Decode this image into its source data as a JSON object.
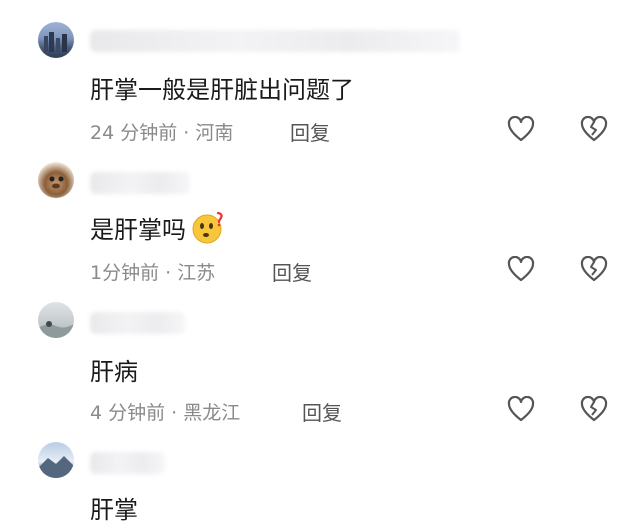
{
  "comments": [
    {
      "text": "肝掌一般是肝脏出问题了",
      "time": "24 分钟前 · 河南",
      "reply": "回复",
      "avatar": "city-skyline-avatar"
    },
    {
      "text": "是肝掌吗",
      "time": "1分钟前 · 江苏",
      "reply": "回复",
      "avatar": "pet-avatar",
      "emoji": "thinking-face-icon"
    },
    {
      "text": "肝病",
      "time": "4 分钟前 · 黑龙江",
      "reply": "回复",
      "avatar": "landscape-avatar"
    },
    {
      "text": "肝掌",
      "avatar": "mountain-avatar"
    }
  ],
  "colors": {
    "text": "#1a1a1a",
    "meta": "#8a8a8a",
    "icon": "#555555"
  }
}
